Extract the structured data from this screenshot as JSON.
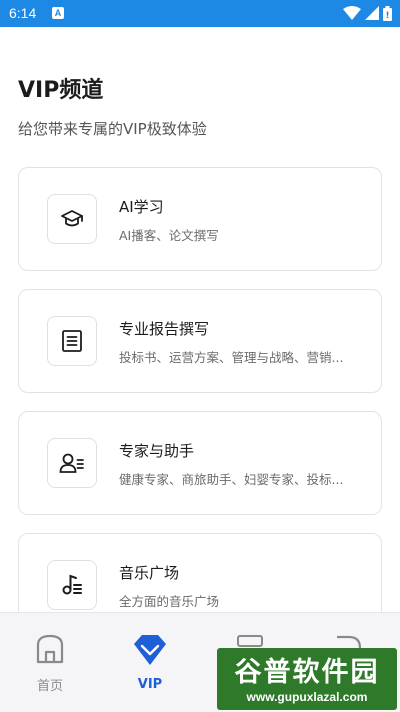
{
  "status_bar": {
    "time": "6:14",
    "notification_letter": "A"
  },
  "header": {
    "title": "VIP频道",
    "subtitle": "给您带来专属的VIP极致体验"
  },
  "cards": [
    {
      "title": "AI学习",
      "desc": "AI播客、论文撰写",
      "icon": "graduation-cap-icon"
    },
    {
      "title": "专业报告撰写",
      "desc": "投标书、运营方案、管理与战略、营销...",
      "icon": "document-list-icon"
    },
    {
      "title": "专家与助手",
      "desc": "健康专家、商旅助手、妇婴专家、投标...",
      "icon": "expert-user-icon"
    },
    {
      "title": "音乐广场",
      "desc": "全方面的音乐广场",
      "icon": "music-note-icon"
    }
  ],
  "bottom_nav": {
    "items": [
      {
        "label": "首页",
        "icon": "home-icon",
        "active": false
      },
      {
        "label": "VIP",
        "icon": "vip-diamond-icon",
        "active": true
      },
      {
        "label": "",
        "icon": "server-icon",
        "active": false
      },
      {
        "label": "",
        "icon": "profile-icon",
        "active": false
      }
    ]
  },
  "watermark": {
    "title": "谷普软件园",
    "url": "www.gupuxlazal.com"
  },
  "colors": {
    "status_bar": "#1e88e5",
    "accent": "#1e5fd6",
    "watermark": "#2e7a2a"
  }
}
